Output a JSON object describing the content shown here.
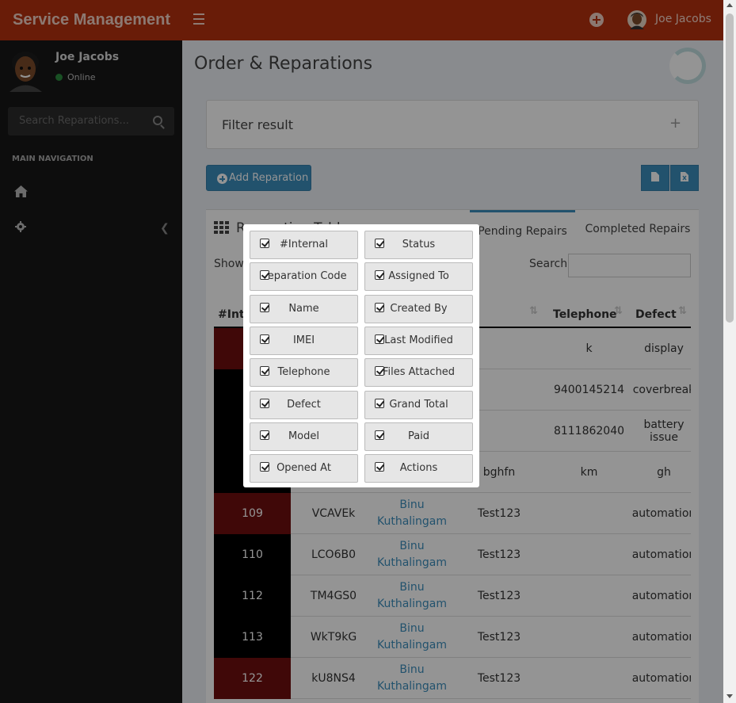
{
  "header": {
    "brand": "Service Management",
    "user_name": "Joe Jacobs"
  },
  "sidebar": {
    "user_name": "Joe Jacobs",
    "status": "Online",
    "search_placeholder": "Search Reparations...",
    "nav_heading": "MAIN NAVIGATION"
  },
  "page": {
    "title": "Order & Reparations",
    "filter_label": "Filter result",
    "filter_toggle": "+",
    "add_button": "Add Reparation",
    "box_title": "Reparation Table",
    "tabs": [
      "Pending Repairs",
      "Completed Repairs"
    ],
    "show_label": "Show",
    "search_label": "Search"
  },
  "table": {
    "columns": [
      "#Internal",
      "Telephone",
      "Defect"
    ],
    "rows": [
      {
        "id": "",
        "code": "",
        "name": "",
        "col4": "",
        "tel": "k",
        "defect": "display"
      },
      {
        "id": "",
        "code": "",
        "name": "",
        "col4": "",
        "tel": "9400145214",
        "defect": "coverbreak"
      },
      {
        "id": "",
        "code": "",
        "name": "",
        "col4": "",
        "tel": "8111862040",
        "defect": "battery issue"
      },
      {
        "id": "",
        "code": "",
        "name": "",
        "col4": "bghfn",
        "tel": "km",
        "defect": "gh"
      },
      {
        "id": "109",
        "code": "VCAVEk",
        "name": "Binu Kuthalingam",
        "col4": "Test123",
        "tel": "",
        "defect": "automation"
      },
      {
        "id": "110",
        "code": "LCO6B0",
        "name": "Binu Kuthalingam",
        "col4": "Test123",
        "tel": "",
        "defect": "automation"
      },
      {
        "id": "112",
        "code": "TM4GS0",
        "name": "Binu Kuthalingam",
        "col4": "Test123",
        "tel": "",
        "defect": "automation"
      },
      {
        "id": "113",
        "code": "WkT9kG",
        "name": "Binu Kuthalingam",
        "col4": "Test123",
        "tel": "",
        "defect": "automation"
      },
      {
        "id": "122",
        "code": "kU8NS4",
        "name": "Binu Kuthalingam",
        "col4": "Test123",
        "tel": "",
        "defect": "automation"
      }
    ],
    "row_colors": [
      "#6e0f0f",
      "#000000",
      "#000000",
      "#000000",
      "#6e0f0f",
      "#000000",
      "#000000",
      "#000000",
      "#6e0f0f"
    ]
  },
  "column_toggle": {
    "left": [
      "#Internal",
      "Reparation Code",
      "Name",
      "IMEI",
      "Telephone",
      "Defect",
      "Model",
      "Opened At"
    ],
    "right": [
      "Status",
      "Assigned To",
      "Created By",
      "Last Modified",
      "Files Attached",
      "Grand Total",
      "Paid",
      "Actions"
    ]
  },
  "colors": {
    "header": "#b5310f",
    "sidebar": "#171717",
    "accent": "#3c8dbc"
  }
}
